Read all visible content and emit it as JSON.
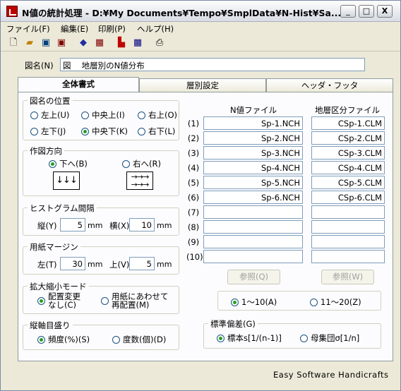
{
  "window": {
    "title": "N値の統計処理 - D:¥My Documents¥Tempo¥SmplData¥N-Hist¥Sa...",
    "min": "_",
    "max": "□",
    "close": "X"
  },
  "menu": [
    "ファイル(F)",
    "編集(E)",
    "印刷(P)",
    "ヘルプ(H)"
  ],
  "chart_name": {
    "label": "図名(N)",
    "value": "図　 地層別のN値分布"
  },
  "tabs": [
    "全体書式",
    "層別設定",
    "ヘッダ・フッタ"
  ],
  "pos_group": {
    "title": "図名の位置",
    "options": [
      "左上(U)",
      "中央上(I)",
      "右上(O)",
      "左下(J)",
      "中央下(K)",
      "右下(L)"
    ],
    "selected": "中央下(K)"
  },
  "dir_group": {
    "title": "作図方向",
    "down": "下へ(B)",
    "right": "右へ(R)",
    "selected": "下へ(B)",
    "down_glyph": "↓↓↓",
    "right_glyph": "→→→"
  },
  "hist_group": {
    "title": "ヒストグラム間隔",
    "v_label": "縦(Y)",
    "v_value": "5",
    "h_label": "横(X)",
    "h_value": "10",
    "unit": "mm"
  },
  "margin_group": {
    "title": "用紙マージン",
    "l_label": "左(T)",
    "l_value": "30",
    "t_label": "上(V)",
    "t_value": "5",
    "unit": "mm"
  },
  "zoom_group": {
    "title": "拡大縮小モード",
    "opt1a": "配置変更",
    "opt1b": "なし(C)",
    "opt2a": "用紙にあわせて",
    "opt2b": "再配置(M)",
    "selected": "opt1"
  },
  "axis_group": {
    "title": "縦軸目盛り",
    "opt1": "頻度(%)(S)",
    "opt2": "度数(個)(D)",
    "selected": "opt1"
  },
  "files": {
    "col1": "N値ファイル",
    "col2": "地層区分ファイル",
    "rows": [
      {
        "n": "(1)",
        "a": "Sp-1.NCH",
        "b": "CSp-1.CLM"
      },
      {
        "n": "(2)",
        "a": "Sp-2.NCH",
        "b": "CSp-2.CLM"
      },
      {
        "n": "(3)",
        "a": "Sp-3.NCH",
        "b": "CSp-3.CLM"
      },
      {
        "n": "(4)",
        "a": "Sp-4.NCH",
        "b": "CSp-4.CLM"
      },
      {
        "n": "(5)",
        "a": "Sp-5.NCH",
        "b": "CSp-5.CLM"
      },
      {
        "n": "(6)",
        "a": "Sp-6.NCH",
        "b": "CSp-6.CLM"
      },
      {
        "n": "(7)",
        "a": "",
        "b": ""
      },
      {
        "n": "(8)",
        "a": "",
        "b": ""
      },
      {
        "n": "(9)",
        "a": "",
        "b": ""
      },
      {
        "n": "(10)",
        "a": "",
        "b": ""
      }
    ],
    "browse1": "参照(Q)",
    "browse2": "参照(W)",
    "range1": "1～10(A)",
    "range2": "11～20(Z)",
    "range_selected": "range1"
  },
  "std_group": {
    "title": "標準偏差(G)",
    "opt1": "標本s[1/(n-1)]",
    "opt2": "母集団σ[1/n]",
    "selected": "opt1"
  },
  "footer": "Easy  Software  Handicrafts"
}
